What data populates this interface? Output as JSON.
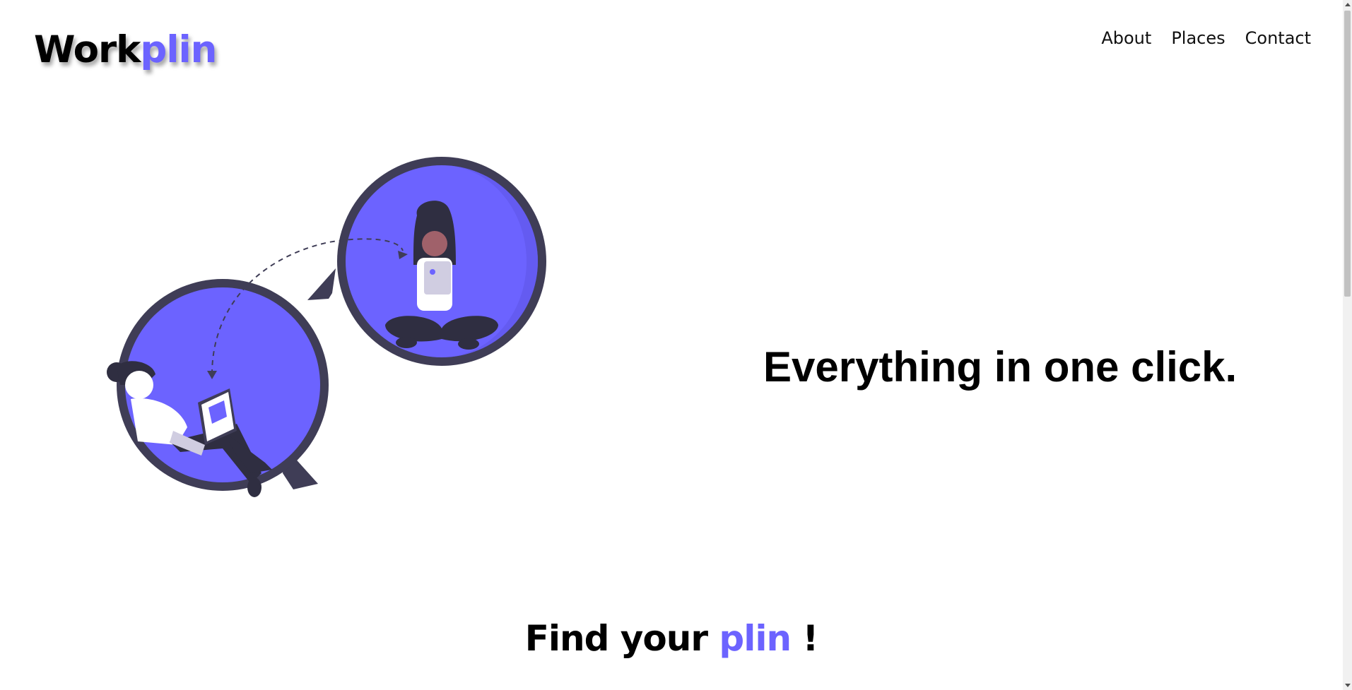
{
  "header": {
    "logo_part1": "Work",
    "logo_part2": "plin",
    "nav": [
      {
        "label": "About"
      },
      {
        "label": "Places"
      },
      {
        "label": "Contact"
      }
    ]
  },
  "hero": {
    "tagline": "Everything in one click.",
    "illustration_icon": "chat-bubbles-illustration"
  },
  "section": {
    "title_part1": "Find your",
    "title_accent": "plin",
    "title_part2": "!"
  },
  "colors": {
    "accent": "#6c63ff",
    "outline": "#3f3d56",
    "text": "#000000"
  }
}
